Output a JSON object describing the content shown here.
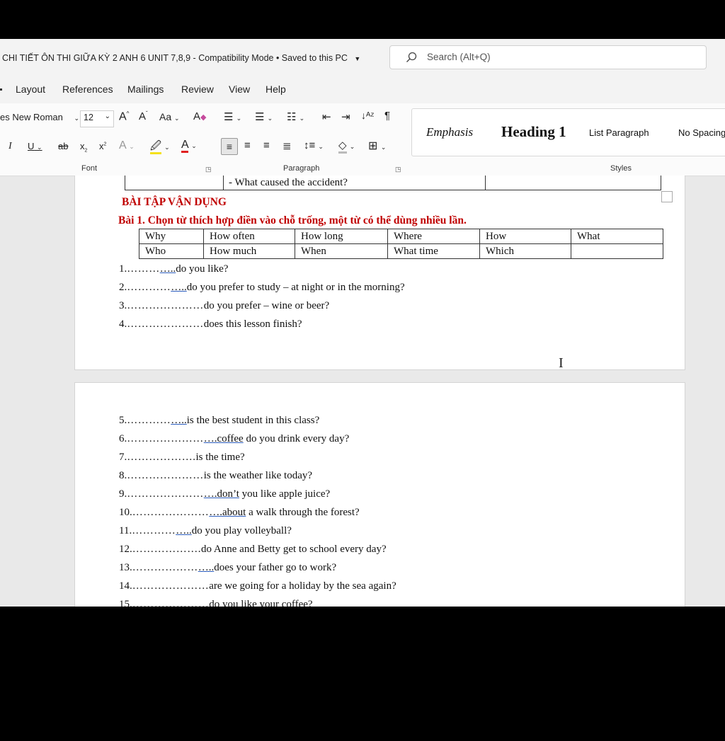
{
  "title_bar": {
    "doc_title": "CHI TIẾT ÔN THI GIỮA KỲ 2 ANH 6 UNIT 7,8,9  -  Compatibility Mode • Saved to this PC",
    "search_placeholder": "Search (Alt+Q)"
  },
  "menu": [
    "Layout",
    "References",
    "Mailings",
    "Review",
    "View",
    "Help"
  ],
  "ribbon": {
    "font_name": "es New Roman",
    "font_size": "12",
    "grow_font": "A",
    "shrink_font": "A",
    "change_case": "Aa",
    "italic": "I",
    "underline": "U",
    "strike": "ab",
    "subscript": "x",
    "superscript": "x",
    "font_label": "Font",
    "paragraph_label": "Paragraph",
    "styles_label": "Styles",
    "styles": [
      "Emphasis",
      "Heading 1",
      "List Paragraph",
      "No Spacing"
    ]
  },
  "document": {
    "prev_row_text": "- What caused the accident?",
    "section_heading": "BÀI TẬP VẬN DỤNG",
    "exercise_title": "Bài 1. Chọn từ thích hợp điền vào chỗ trống, một từ có thể dùng nhiều lần.",
    "word_table": [
      [
        "Why",
        "How often",
        "How long",
        "Where",
        "How",
        "What"
      ],
      [
        "Who",
        "How much",
        "When",
        "What time",
        "Which",
        ""
      ]
    ],
    "page1_items": [
      {
        "num": "1.",
        "dots": "………",
        "und": "…..",
        "text": "do you like?"
      },
      {
        "num": "2.",
        "dots": "…………",
        "und": "…..",
        "text": "do you prefer to study – at night or in the morning?"
      },
      {
        "num": "3.",
        "dots": "…………………",
        "und": "",
        "text": "do you prefer – wine or beer?"
      },
      {
        "num": "4.",
        "dots": "…………………",
        "und": "",
        "text": "does this lesson finish?"
      }
    ],
    "page2_items": [
      {
        "num": "5.",
        "dots": "…………",
        "und": "…..",
        "text": "is the best student in this class?"
      },
      {
        "num": "6.",
        "dots": "…………………",
        "und": "….coffee",
        "text": " do you drink every day?"
      },
      {
        "num": "7.",
        "dots": "……………….",
        "und": "",
        "text": "is the time?"
      },
      {
        "num": "8.",
        "dots": "…………………",
        "und": "",
        "text": "is the weather like today?"
      },
      {
        "num": "9.",
        "dots": "…………………",
        "und": "….don’t",
        "text": " you like apple juice?"
      },
      {
        "num": "10.",
        "dots": "…………………",
        "und": "….about",
        "text": " a walk through the forest?"
      },
      {
        "num": "11.",
        "dots": "…………",
        "und": "…..",
        "text": "do you play volleyball?"
      },
      {
        "num": "12.",
        "dots": "……………….",
        "und": "",
        "text": "do Anne and Betty get to school every day?"
      },
      {
        "num": "13.",
        "dots": "………………",
        "und": "…..",
        "text": "does your father go to work?"
      },
      {
        "num": "14.",
        "dots": "…………………",
        "und": "",
        "text": "are we going for a holiday by the sea again?"
      },
      {
        "num": "15.",
        "dots": "…………………",
        "und": "",
        "text": "do you like your coffee?"
      }
    ]
  }
}
